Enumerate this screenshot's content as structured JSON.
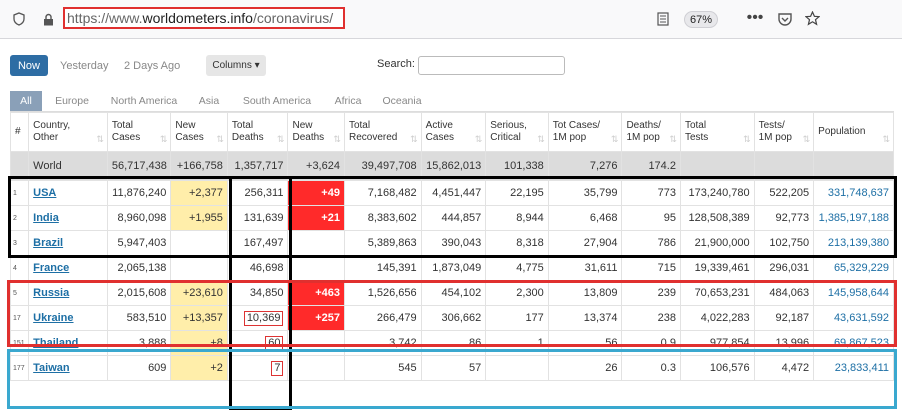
{
  "browser": {
    "url_prefix": "https://www.",
    "url_domain": "worldometers.info",
    "url_path": "/coronavirus/",
    "zoom": "67%",
    "shield_icon": "shield-icon",
    "lock_icon": "lock-icon"
  },
  "controls": {
    "now": "Now",
    "yesterday": "Yesterday",
    "two_days_ago": "2 Days Ago",
    "columns": "Columns ▾",
    "search_label": "Search:",
    "search_value": ""
  },
  "tabs": [
    "All",
    "Europe",
    "North America",
    "Asia",
    "South America",
    "Africa",
    "Oceania"
  ],
  "headers": [
    "#",
    "Country,\nOther",
    "Total\nCases",
    "New\nCases",
    "Total\nDeaths",
    "New\nDeaths",
    "Total\nRecovered",
    "Active\nCases",
    "Serious,\nCritical",
    "Tot Cases/\n1M pop",
    "Deaths/\n1M pop",
    "Total\nTests",
    "Tests/\n1M pop",
    "Population"
  ],
  "world": [
    "",
    "World",
    "56,717,438",
    "+166,758",
    "1,357,717",
    "+3,624",
    "39,497,708",
    "15,862,013",
    "101,338",
    "7,276",
    "174.2",
    "",
    "",
    ""
  ],
  "rows": [
    [
      "1",
      "USA",
      "11,876,240",
      "+2,377",
      "256,311",
      "+49",
      "7,168,482",
      "4,451,447",
      "22,195",
      "35,799",
      "773",
      "173,240,780",
      "522,205",
      "331,748,637"
    ],
    [
      "2",
      "India",
      "8,960,098",
      "+1,955",
      "131,639",
      "+21",
      "8,383,602",
      "444,857",
      "8,944",
      "6,468",
      "95",
      "128,508,389",
      "92,773",
      "1,385,197,188"
    ],
    [
      "3",
      "Brazil",
      "5,947,403",
      "",
      "167,497",
      "",
      "5,389,863",
      "390,043",
      "8,318",
      "27,904",
      "786",
      "21,900,000",
      "102,750",
      "213,139,380"
    ],
    [
      "4",
      "France",
      "2,065,138",
      "",
      "46,698",
      "",
      "145,391",
      "1,873,049",
      "4,775",
      "31,611",
      "715",
      "19,339,461",
      "296,031",
      "65,329,229"
    ],
    [
      "5",
      "Russia",
      "2,015,608",
      "+23,610",
      "34,850",
      "+463",
      "1,526,656",
      "454,102",
      "2,300",
      "13,809",
      "239",
      "70,653,231",
      "484,063",
      "145,958,644"
    ],
    [
      "17",
      "Ukraine",
      "583,510",
      "+13,357",
      "10,369",
      "+257",
      "266,479",
      "306,662",
      "177",
      "13,374",
      "238",
      "4,022,283",
      "92,187",
      "43,631,592"
    ],
    [
      "151",
      "Thailand",
      "3,888",
      "+8",
      "60",
      "",
      "3,742",
      "86",
      "1",
      "56",
      "0.9",
      "977,854",
      "13,996",
      "69,867,523"
    ],
    [
      "177",
      "Taiwan",
      "609",
      "+2",
      "7",
      "",
      "545",
      "57",
      "",
      "26",
      "0.3",
      "106,576",
      "4,472",
      "23,833,411"
    ]
  ],
  "colors": {
    "accent": "#2e6da4",
    "new_cases": "#ffeeaa",
    "new_deaths": "#ff2a2a",
    "link": "#1d6fa5"
  }
}
